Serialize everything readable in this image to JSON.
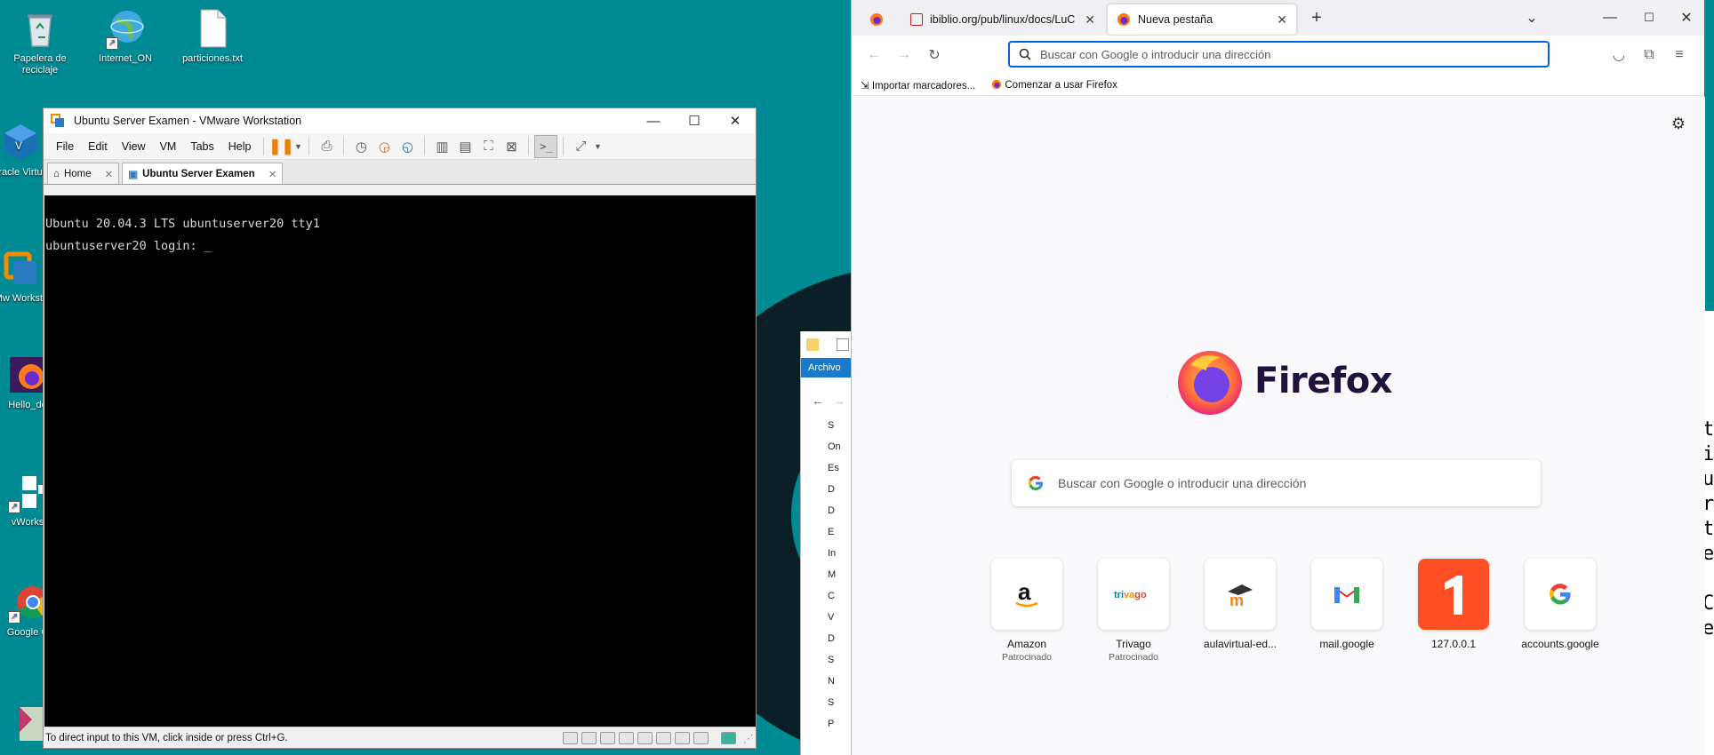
{
  "desktop": {
    "icons": [
      {
        "label": "Papelera de reciclaje",
        "icon": "recycle-bin-icon"
      },
      {
        "label": "Internet_ON",
        "icon": "globe-icon"
      },
      {
        "label": "particiones.txt",
        "icon": "text-file-icon"
      },
      {
        "label": "Oracle Virtual",
        "icon": "virtualbox-icon"
      },
      {
        "label": "VMw Workstati",
        "icon": "vmware-icon"
      },
      {
        "label": "Hello_do",
        "icon": "firefox-icon"
      },
      {
        "label": "vWorks",
        "icon": "app-icon"
      },
      {
        "label": "Google C",
        "icon": "chrome-icon"
      }
    ]
  },
  "vmware": {
    "title": "Ubuntu Server Examen - VMware Workstation",
    "menu": [
      "File",
      "Edit",
      "View",
      "VM",
      "Tabs",
      "Help"
    ],
    "tabs": [
      {
        "label": "Home"
      },
      {
        "label": "Ubuntu Server Examen"
      }
    ],
    "console_lines": [
      "Ubuntu 20.04.3 LTS ubuntuserver20 tty1",
      "",
      "ubuntuserver20 login: _"
    ],
    "status_text": "To direct input to this VM, click inside or press Ctrl+G."
  },
  "explorer": {
    "ribbon_tab": "Archivo",
    "rows": [
      "S",
      "On",
      "Es",
      "D",
      "D",
      "E",
      "In",
      "M",
      "C",
      "V",
      "D",
      "S",
      "N",
      "S",
      "P"
    ]
  },
  "right_window": {
    "chars": [
      "t",
      "i",
      "u",
      "r",
      "t",
      "e",
      "",
      "C",
      "e"
    ]
  },
  "firefox": {
    "tabs": [
      {
        "label": "",
        "icon": "firefox-icon"
      },
      {
        "label": "ibiblio.org/pub/linux/docs/LuC",
        "icon": "pdf-icon"
      },
      {
        "label": "Nueva pestaña",
        "icon": "firefox-icon"
      }
    ],
    "url_placeholder": "Buscar con Google o introducir una dirección",
    "bookmarks": [
      "Importar marcadores...",
      "Comenzar a usar Firefox"
    ],
    "brand": "Firefox",
    "search_placeholder": "Buscar con Google o introducir una dirección",
    "shortcuts": [
      {
        "title": "Amazon",
        "sub": "Patrocinado"
      },
      {
        "title": "Trivago",
        "sub": "Patrocinado"
      },
      {
        "title": "aulavirtual-ed...",
        "sub": ""
      },
      {
        "title": "mail.google",
        "sub": ""
      },
      {
        "title": "127.0.0.1",
        "sub": ""
      },
      {
        "title": "accounts.google",
        "sub": ""
      }
    ]
  },
  "colors": {
    "desktop_bg": "#008b94",
    "ff_accent": "#0061e0",
    "vm_accent": "#ff7f00"
  }
}
